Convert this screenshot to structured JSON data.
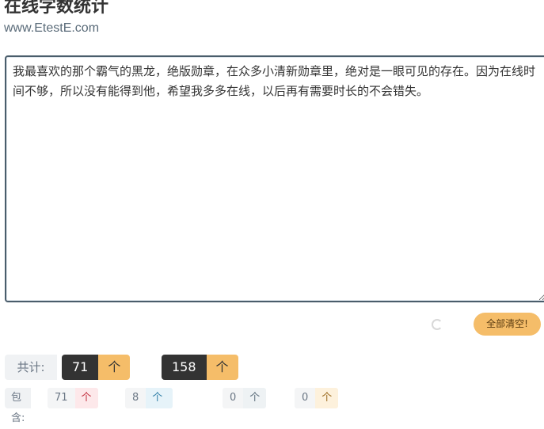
{
  "header": {
    "title": "在线字数统计",
    "subtitle": "www.EtestE.com"
  },
  "editor": {
    "value": "我最喜欢的那个霸气的黑龙，绝版勋章，在众多小清新勋章里，绝对是一眼可见的存在。因为在线时间不够，所以没有能得到他，希望我多多在线，以后再有需要时长的不会错失。"
  },
  "actions": {
    "clear_label": "全部清空!"
  },
  "stats": {
    "total_label": "共计:",
    "word_count": "71",
    "word_unit": "个字数",
    "char_count": "158",
    "char_unit": "个字符"
  },
  "contains": {
    "label": "包含:",
    "hanzi_count": "71",
    "hanzi_unit": "个汉字",
    "punct_count": "8",
    "punct_unit": "个标点(全角)",
    "letter_count": "0",
    "letter_unit": "个字母",
    "digit_count": "0",
    "digit_unit": "个数字"
  },
  "colors": {
    "accent": "#f5bd69",
    "dark": "#333333",
    "hanzi_tag": "#c2303f",
    "punct_tag": "#2f7ea6"
  }
}
